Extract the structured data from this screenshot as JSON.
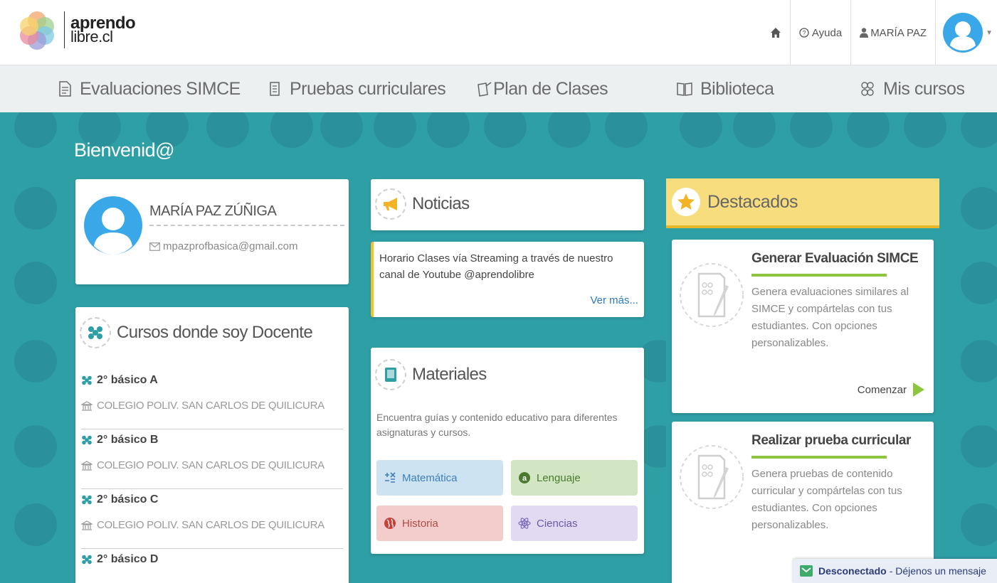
{
  "brand": {
    "line1": "aprendo",
    "line2": "libre.cl"
  },
  "topnav": {
    "home_icon": "home-icon",
    "help_label": "Ayuda",
    "user_label": "MARÍA PAZ"
  },
  "mainnav": [
    {
      "label": "Evaluaciones SIMCE",
      "icon": "document-icon"
    },
    {
      "label": "Pruebas curriculares",
      "icon": "scroll-icon"
    },
    {
      "label": "Plan de Clases",
      "icon": "lesson-plan-icon"
    },
    {
      "label": "Biblioteca",
      "icon": "book-icon"
    },
    {
      "label": "Mis cursos",
      "icon": "group-icon"
    }
  ],
  "welcome": "Bienvenid@",
  "profile": {
    "name": "MARÍA PAZ ZÚÑIGA",
    "email": "mpazprofbasica@gmail.com"
  },
  "courses": {
    "title": "Cursos donde soy Docente",
    "items": [
      {
        "name": "2° básico A",
        "school": "COLEGIO POLIV. SAN CARLOS DE QUILICURA"
      },
      {
        "name": "2° básico B",
        "school": "COLEGIO POLIV. SAN CARLOS DE QUILICURA"
      },
      {
        "name": "2° básico C",
        "school": "COLEGIO POLIV. SAN CARLOS DE QUILICURA"
      },
      {
        "name": "2° básico D",
        "school": ""
      }
    ]
  },
  "news": {
    "title": "Noticias",
    "item_text": "Horario Clases vía Streaming a través de nuestro canal de Youtube @aprendolibre",
    "more": "Ver más..."
  },
  "materials": {
    "title": "Materiales",
    "description": "Encuentra guías y contenido educativo para diferentes asignaturas y cursos.",
    "subjects": [
      {
        "label": "Matemática",
        "color": "#cde3f1",
        "text_color": "#3f7fb8"
      },
      {
        "label": "Lenguaje",
        "color": "#d3e6c4",
        "text_color": "#4a7a2f"
      },
      {
        "label": "Historia",
        "color": "#f3cccc",
        "text_color": "#b24a45"
      },
      {
        "label": "Ciencias",
        "color": "#e2daf2",
        "text_color": "#6a5aa6"
      }
    ]
  },
  "featured": {
    "title": "Destacados",
    "items": [
      {
        "title": "Generar Evaluación SIMCE",
        "description": "Genera evaluaciones similares al SIMCE y compártelas con tus estudiantes. Con opciones personalizables.",
        "cta": "Comenzar"
      },
      {
        "title": "Realizar prueba curricular",
        "description": "Genera pruebas de contenido curricular y compártelas con tus estudiantes. Con opciones personalizables.",
        "cta": ""
      }
    ]
  },
  "chat": {
    "status": "Desconectado",
    "message": "- Déjenos un mensaje"
  },
  "colors": {
    "accent": "#2f9fa6",
    "nav_bg": "#ecf0f1",
    "highlight": "#f8dd7e",
    "green": "#8cc63f"
  }
}
